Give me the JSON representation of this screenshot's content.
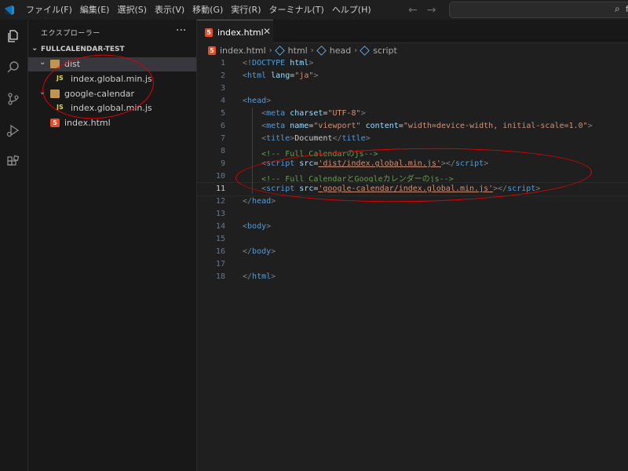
{
  "colors": {
    "accent": "#0078d4",
    "annotation": "#e00000",
    "html_icon": "#e44d26",
    "js_icon": "#e8d44d",
    "folder_icon": "#c09553"
  },
  "titlebar": {
    "menu": [
      "ファイル(F)",
      "編集(E)",
      "選択(S)",
      "表示(V)",
      "移動(G)",
      "実行(R)",
      "ターミナル(T)",
      "ヘルプ(H)"
    ],
    "search_icon": "search-icon",
    "search_text": "f"
  },
  "activity": [
    "files-icon",
    "search-icon",
    "source-control-icon",
    "run-debug-icon",
    "extensions-icon"
  ],
  "sidebar": {
    "title": "エクスプローラー",
    "more": "···",
    "folder": "FULLCALENDAR-TEST",
    "tree": [
      {
        "label": "dist",
        "type": "folder"
      },
      {
        "label": "index.global.min.js",
        "type": "js",
        "icon_text": "JS"
      },
      {
        "label": "google-calendar",
        "type": "folder"
      },
      {
        "label": "index.global.min.js",
        "type": "js",
        "icon_text": "JS"
      },
      {
        "label": "index.html",
        "type": "html"
      }
    ]
  },
  "editor": {
    "tab_label": "index.html",
    "tab_close": "✕",
    "breadcrumb": [
      "index.html",
      "html",
      "head",
      "script"
    ],
    "line_numbers": [
      "1",
      "2",
      "3",
      "4",
      "5",
      "6",
      "7",
      "8",
      "9",
      "10",
      "11",
      "12",
      "13",
      "14",
      "15",
      "16",
      "17",
      "18"
    ],
    "active_line": "11",
    "code": {
      "l1_a": "<!",
      "l1_b": "DOCTYPE",
      "l1_c": " html",
      "l1_d": ">",
      "l2_lang": "\"ja\"",
      "l5_charset": "\"UTF-8\"",
      "l6_name": "\"viewport\"",
      "l6_content": "\"width=device-width, initial-scale=1.0\"",
      "l7_title": "Document",
      "l8_comment": "<!-- Full Calendarのjs-->",
      "l9_src": "'dist/index.global.min.js'",
      "l10_comment": "<!-- Full CalendarとGoogleカレンダーのjs-->",
      "l11_src": "'google-calendar/index.global.min.js'"
    }
  }
}
